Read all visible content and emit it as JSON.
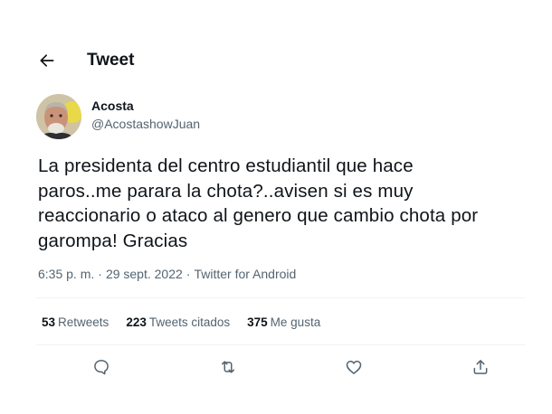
{
  "header": {
    "title": "Tweet",
    "back_icon": "back-arrow-icon"
  },
  "author": {
    "name": "Acosta",
    "handle": "@AcostashowJuan"
  },
  "tweet": {
    "text_lines": [
      "La presidenta del centro estudiantil que hace",
      "paros..me parara la chota?..avisen si es muy",
      "reaccionario o ataco al genero que cambio chota por",
      "garompa! Gracias"
    ]
  },
  "meta": {
    "time": "6:35 p. m.",
    "separator": "·",
    "date": "29 sept. 2022",
    "source": "Twitter for Android"
  },
  "stats": {
    "retweets_count": "53",
    "retweets_label": "Retweets",
    "quotes_count": "223",
    "quotes_label": "Tweets citados",
    "likes_count": "375",
    "likes_label": "Me gusta"
  },
  "actions": {
    "icons": [
      "reply-icon",
      "retweet-icon",
      "like-icon",
      "share-icon"
    ]
  },
  "colors": {
    "text_primary": "#0f1419",
    "text_secondary": "#536471",
    "divider": "#eff3f4"
  }
}
